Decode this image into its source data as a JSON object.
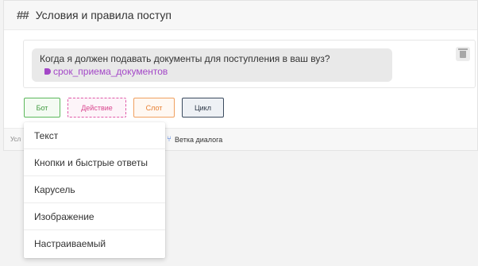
{
  "header": {
    "title": "Условия и правила поступ"
  },
  "message": {
    "text": "Когда я должен подавать документы для поступления в ваш вуз?",
    "tag": "срок_приема_документов"
  },
  "chips": {
    "bot": "Бот",
    "action": "Действие",
    "slot": "Слот",
    "cycle": "Цикл"
  },
  "footer": {
    "cut_label": "Усл",
    "branch_label": "Ветка диалога"
  },
  "dropdown": {
    "items": [
      "Текст",
      "Кнопки и быстрые ответы",
      "Карусель",
      "Изображение",
      "Настраиваемый"
    ]
  },
  "colors": {
    "bot": "#5cb85c",
    "action": "#e05aa8",
    "slot": "#f0a060",
    "cycle": "#3a4a5e",
    "tag": "#a347c7"
  },
  "icons": {
    "header": "hash-icon",
    "tag": "tag-icon",
    "delete": "trash-icon",
    "branch": "branch-icon"
  }
}
